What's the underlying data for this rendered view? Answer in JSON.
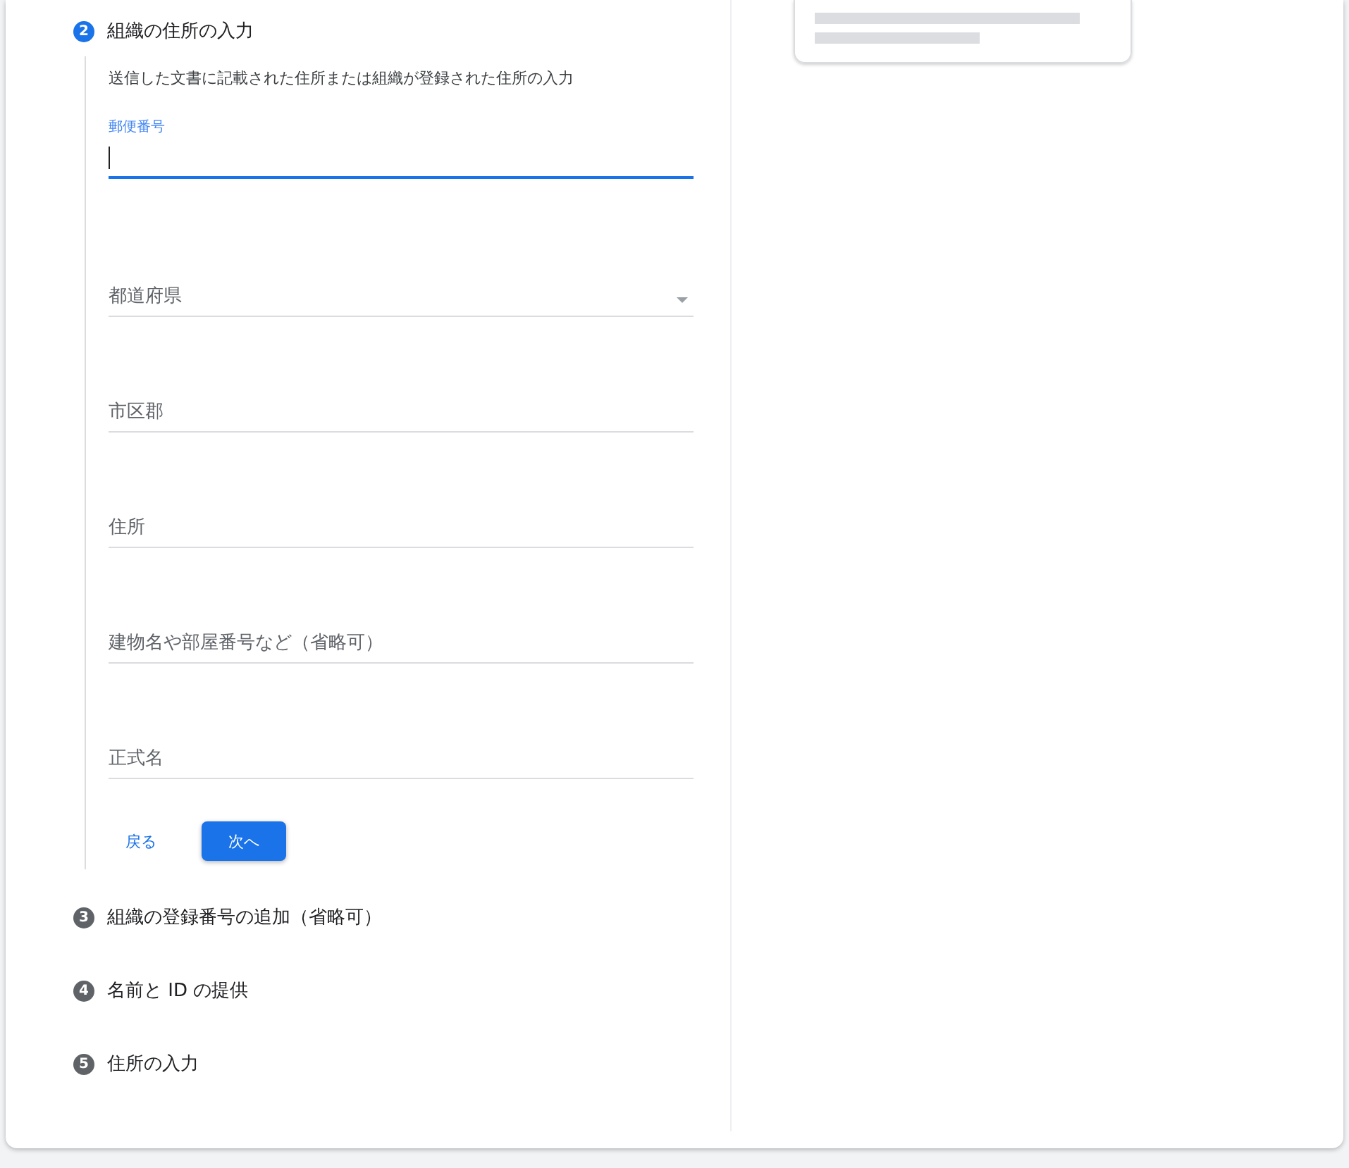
{
  "steps": [
    {
      "number": "2",
      "title": "組織の住所の入力",
      "active": true,
      "description": "送信した文書に記載された住所または組織が登録された住所の入力",
      "fields": [
        {
          "kind": "text",
          "label": "郵便番号",
          "focused": true
        },
        {
          "kind": "select",
          "label": "都道府県",
          "focused": false
        },
        {
          "kind": "text",
          "label": "市区郡",
          "focused": false
        },
        {
          "kind": "text",
          "label": "住所",
          "focused": false
        },
        {
          "kind": "text",
          "label": "建物名や部屋番号など（省略可）",
          "focused": false
        },
        {
          "kind": "text",
          "label": "正式名",
          "focused": false
        }
      ],
      "buttons": [
        {
          "kind": "text",
          "label": "戻る"
        },
        {
          "kind": "filled",
          "label": "次へ"
        }
      ]
    },
    {
      "number": "3",
      "title": "組織の登録番号の追加（省略可）",
      "active": false
    },
    {
      "number": "4",
      "title": "名前と ID の提供",
      "active": false
    },
    {
      "number": "5",
      "title": "住所の入力",
      "active": false
    }
  ],
  "side_card": {
    "kind": "skeleton"
  }
}
